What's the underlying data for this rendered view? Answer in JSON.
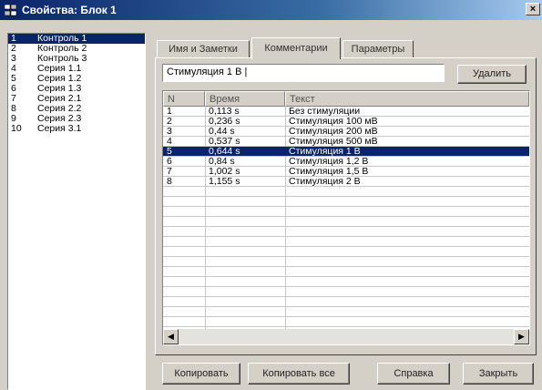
{
  "window": {
    "title": "Свойства: Блок 1",
    "close_glyph": "×"
  },
  "left_list": {
    "items": [
      {
        "num": "1",
        "label": "Контроль 1",
        "selected": true
      },
      {
        "num": "2",
        "label": "Контроль 2",
        "selected": false
      },
      {
        "num": "3",
        "label": "Контроль 3",
        "selected": false
      },
      {
        "num": "4",
        "label": "Серия 1.1",
        "selected": false
      },
      {
        "num": "5",
        "label": "Серия 1.2",
        "selected": false
      },
      {
        "num": "6",
        "label": "Серия 1.3",
        "selected": false
      },
      {
        "num": "7",
        "label": "Серия 2.1",
        "selected": false
      },
      {
        "num": "8",
        "label": "Серия 2.2",
        "selected": false
      },
      {
        "num": "9",
        "label": "Серия 2.3",
        "selected": false
      },
      {
        "num": "10",
        "label": "Серия 3.1",
        "selected": false
      }
    ]
  },
  "tabs": [
    {
      "label": "Имя и Заметки",
      "active": false
    },
    {
      "label": "Комментарии",
      "active": true
    },
    {
      "label": "Параметры",
      "active": false
    }
  ],
  "comment_input": {
    "value": "Стимуляция 1 В |"
  },
  "delete_button": {
    "label": "Удалить"
  },
  "grid": {
    "headers": [
      "N",
      "Время",
      "Текст"
    ],
    "rows": [
      {
        "n": "1",
        "time": "0,113 s",
        "text": "Без стимуляции",
        "selected": false
      },
      {
        "n": "2",
        "time": "0,236 s",
        "text": "Стимуляция 100 мВ",
        "selected": false
      },
      {
        "n": "3",
        "time": "0,44 s",
        "text": "Стимуляция 200 мВ",
        "selected": false
      },
      {
        "n": "4",
        "time": "0,537 s",
        "text": "Стимуляция 500 мВ",
        "selected": false
      },
      {
        "n": "5",
        "time": "0,644 s",
        "text": "Стимуляция 1 В",
        "selected": true
      },
      {
        "n": "6",
        "time": "0,84 s",
        "text": "Стимуляция 1,2 В",
        "selected": false
      },
      {
        "n": "7",
        "time": "1,002 s",
        "text": "Стимуляция 1,5 В",
        "selected": false
      },
      {
        "n": "8",
        "time": "1,155 s",
        "text": "Стимуляция 2 В",
        "selected": false
      }
    ],
    "scroll_left_glyph": "◀",
    "scroll_right_glyph": "▶"
  },
  "buttons": {
    "copy": "Копировать",
    "copy_all": "Копировать все",
    "help": "Справка",
    "close": "Закрыть"
  },
  "colors": {
    "selection": "#0a246a",
    "face": "#d4d0c8",
    "title_start": "#0a246a",
    "title_end": "#a6caf0"
  }
}
